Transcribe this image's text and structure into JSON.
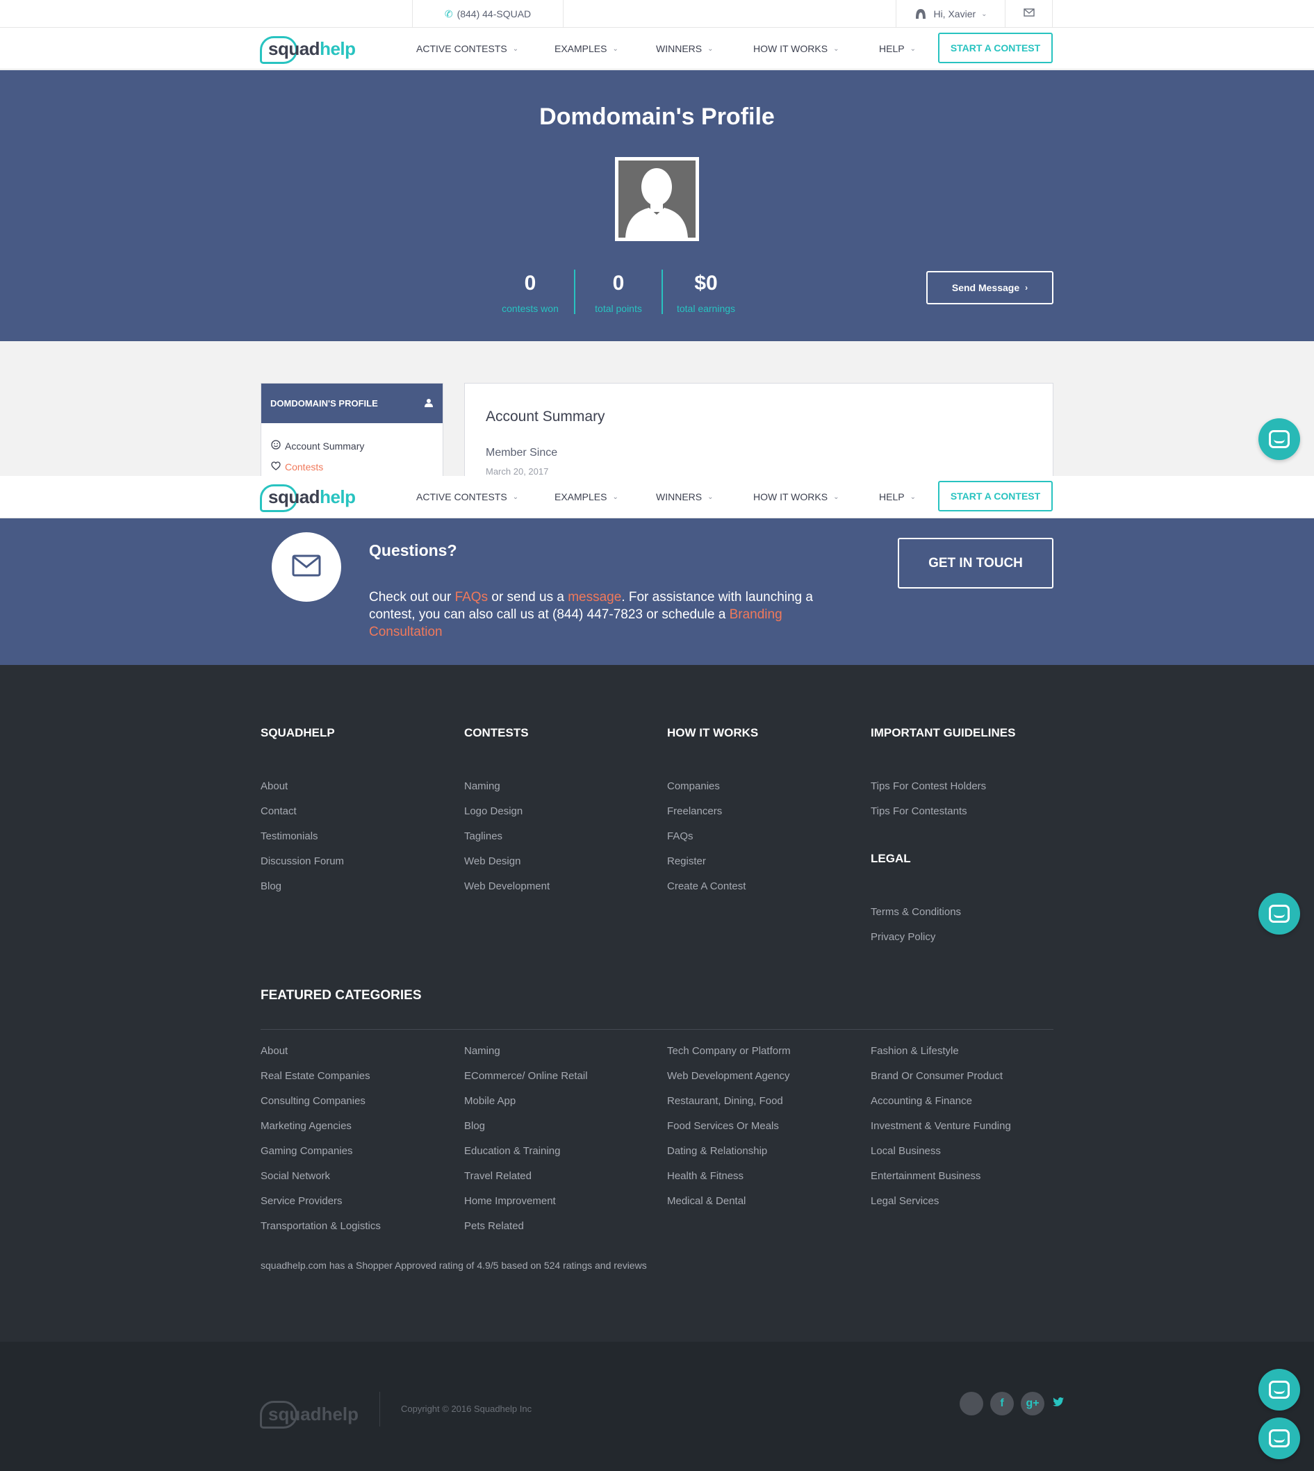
{
  "topbar": {
    "phone": "(844) 44-SQUAD",
    "user_greeting": "Hi, Xavier"
  },
  "logo": {
    "part1": "squad",
    "part2": "help"
  },
  "nav": {
    "items": [
      "ACTIVE CONTESTS",
      "EXAMPLES",
      "WINNERS",
      "HOW IT WORKS",
      "HELP"
    ],
    "cta": "START A CONTEST"
  },
  "hero": {
    "title": "Domdomain's Profile",
    "stats": [
      {
        "value": "0",
        "label": "contests won"
      },
      {
        "value": "0",
        "label": "total points"
      },
      {
        "value": "$0",
        "label": "total earnings"
      }
    ],
    "send_button": "Send Message"
  },
  "profile": {
    "sidebar_title": "DOMDOMAIN'S PROFILE",
    "sidebar_items": [
      "Account Summary",
      "Contests"
    ],
    "panel_title": "Account Summary",
    "member_since_label": "Member Since",
    "member_since_value": "March 20, 2017"
  },
  "questions": {
    "title": "Questions?",
    "t1": "Check out our ",
    "faqs_link": "FAQs",
    "t2": " or send us a ",
    "message_link": "message",
    "t3": ". For assistance with launching a contest, you can also call us at (844) 447-7823 or schedule a ",
    "branding_link": "Branding Consultation",
    "button": "GET IN TOUCH"
  },
  "footer": {
    "columns": [
      {
        "title": "SQUADHELP",
        "links": [
          "About",
          "Contact",
          "Testimonials",
          "Discussion Forum",
          "Blog"
        ]
      },
      {
        "title": "CONTESTS",
        "links": [
          "Naming",
          "Logo Design",
          "Taglines",
          "Web Design",
          "Web Development"
        ]
      },
      {
        "title": "HOW IT WORKS",
        "links": [
          "Companies",
          "Freelancers",
          "FAQs",
          "Register",
          "Create A Contest"
        ]
      },
      {
        "title": "IMPORTANT GUIDELINES",
        "links": [
          "Tips For Contest Holders",
          "Tips For Contestants"
        ]
      }
    ],
    "legal": {
      "title": "LEGAL",
      "links": [
        "Terms & Conditions",
        "Privacy Policy"
      ]
    },
    "featured_title": "FEATURED CATEGORIES",
    "featured": [
      [
        "About",
        "Real Estate Companies",
        "Consulting Companies",
        "Marketing Agencies",
        "Gaming Companies",
        "Social Network",
        "Service Providers",
        "Transportation & Logistics"
      ],
      [
        "Naming",
        "ECommerce/ Online Retail",
        "Mobile App",
        "Blog",
        "Education & Training",
        "Travel Related",
        "Home Improvement",
        "Pets Related"
      ],
      [
        "Tech Company or Platform",
        "Web Development Agency",
        "Restaurant, Dining, Food",
        "Food Services Or Meals",
        "Dating & Relationship",
        "Health & Fitness",
        "Medical & Dental"
      ],
      [
        "Fashion & Lifestyle",
        "Brand Or Consumer Product",
        "Accounting & Finance",
        "Investment & Venture Funding",
        "Local Business",
        "Entertainment Business",
        "Legal Services"
      ]
    ],
    "rating": "squadhelp.com has a Shopper Approved rating of 4.9/5 based on 524 ratings and reviews",
    "copyright": "Copyright © 2016 Squadhelp Inc",
    "social": [
      "f",
      "g+"
    ]
  },
  "colors": {
    "brand_teal": "#28c3c0",
    "hero_blue": "#485a85",
    "footer_dark": "#2a2f35",
    "link_orange": "#f0795b"
  }
}
